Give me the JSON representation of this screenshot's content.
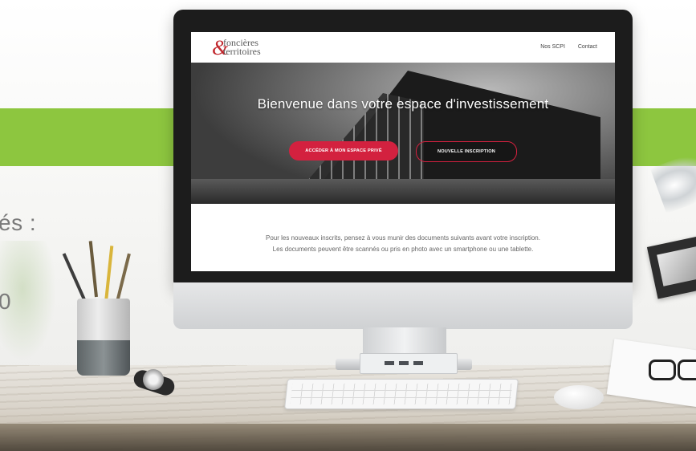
{
  "side_text": {
    "line1": "és :",
    "line2": "0"
  },
  "website": {
    "logo": {
      "line1": "foncières",
      "amp": "&",
      "line2": "territoires"
    },
    "nav": [
      "Nos SCPI",
      "Contact"
    ],
    "hero_title": "Bienvenue dans votre espace d'investissement",
    "buttons": {
      "primary": "ACCÉDER À MON ESPACE PRIVÉ",
      "secondary": "NOUVELLE INSCRIPTION"
    },
    "info_lines": [
      "Pour les nouveaux inscrits, pensez à vous munir des documents suivants avant votre inscription.",
      "Les documents peuvent être scannés ou pris en photo avec un smartphone ou une tablette."
    ]
  },
  "colors": {
    "green_band": "#8dc63f",
    "accent_red": "#d3213f"
  }
}
